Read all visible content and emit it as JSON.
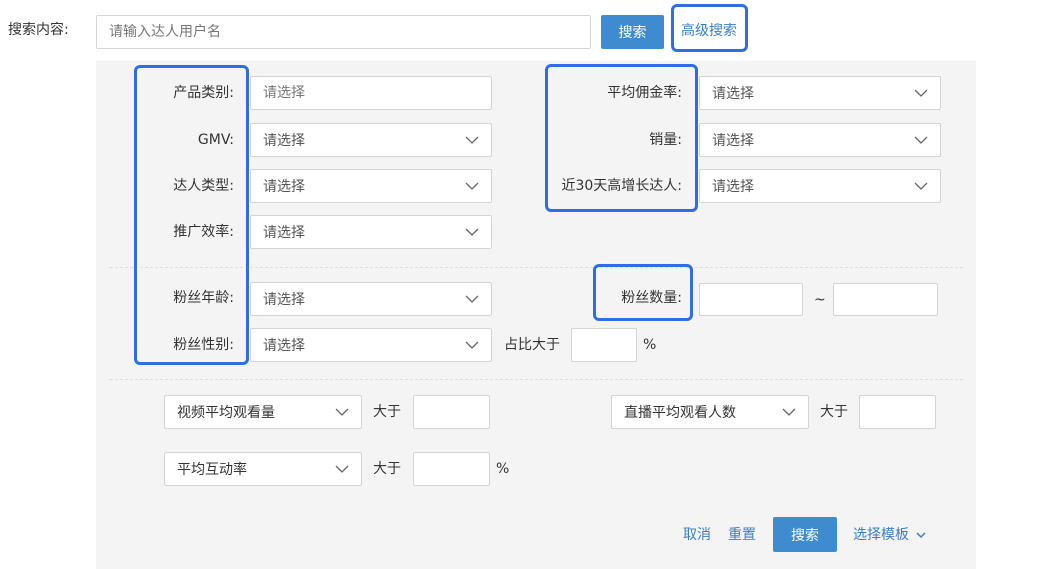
{
  "search": {
    "label": "搜索内容:",
    "placeholder": "请输入达人用户名",
    "value": "",
    "search_button": "搜索",
    "advanced_link": "高级搜索"
  },
  "filters": {
    "product_category": {
      "label": "产品类别:",
      "placeholder": "请选择"
    },
    "gmv": {
      "label": "GMV:",
      "value": "请选择"
    },
    "creator_type": {
      "label": "达人类型:",
      "value": "请选择"
    },
    "promo_efficiency": {
      "label": "推广效率:",
      "value": "请选择"
    },
    "avg_commission": {
      "label": "平均佣金率:",
      "value": "请选择"
    },
    "sales": {
      "label": "销量:",
      "value": "请选择"
    },
    "growth_30d": {
      "label": "近30天高增长达人:",
      "value": "请选择"
    },
    "fan_age": {
      "label": "粉丝年龄:",
      "value": "请选择"
    },
    "fan_gender": {
      "label": "粉丝性别:",
      "value": "请选择"
    },
    "ratio_label": "占比大于",
    "percent": "%",
    "fan_count": {
      "label": "粉丝数量:",
      "range_sep": "~"
    }
  },
  "metrics": {
    "video_avg_views": {
      "value": "视频平均观看量",
      "gt_label": "大于"
    },
    "live_avg_viewers": {
      "value": "直播平均观看人数",
      "gt_label": "大于"
    },
    "avg_interaction": {
      "value": "平均互动率",
      "gt_label": "大于",
      "unit": "%"
    }
  },
  "actions": {
    "cancel": "取消",
    "reset": "重置",
    "search": "搜索",
    "template": "选择模板"
  },
  "colors": {
    "accent": "#3f8bd0",
    "link": "#3a7fc6",
    "highlight": "#2f6ee2",
    "panel_bg": "#f4f4f4"
  }
}
